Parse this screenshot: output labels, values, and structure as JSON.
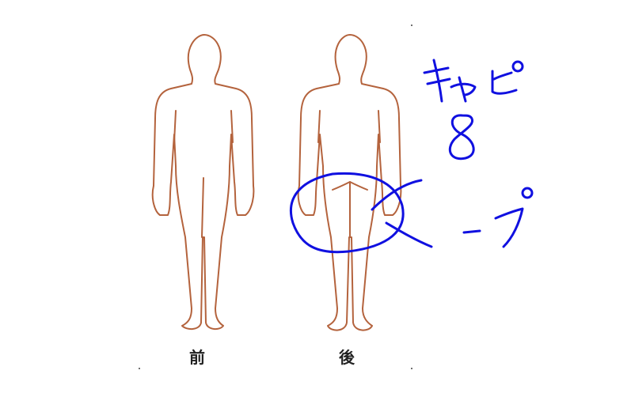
{
  "labels": {
    "front": "前",
    "back": "後"
  },
  "handwriting": {
    "word_top": "キャピ",
    "digit": "8",
    "word_bottom": "ープ"
  },
  "colors": {
    "body_outline": "#b4633d",
    "ink": "#1010e0"
  }
}
